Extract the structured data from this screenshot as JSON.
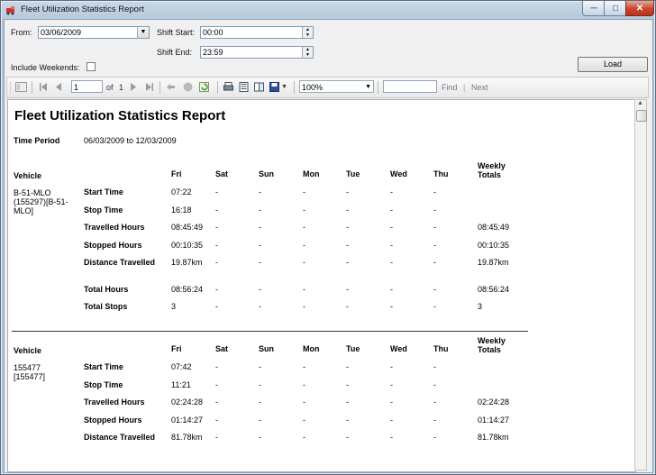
{
  "window": {
    "title": "Fleet Utilization Statistics Report",
    "min": "─",
    "max": "□",
    "close": "✕"
  },
  "params": {
    "from_label": "From:",
    "from_value": "03/06/2009",
    "shift_start_label": "Shift Start:",
    "shift_start_value": "00:00",
    "shift_end_label": "Shift End:",
    "shift_end_value": "23:59",
    "include_weekends_label": "Include Weekends:",
    "include_weekends_checked": false,
    "load_label": "Load"
  },
  "toolbar": {
    "page_value": "1",
    "of_label": "of",
    "total_pages": "1",
    "zoom": "100%",
    "find_value": "",
    "find_label": "Find",
    "sep": "|",
    "next_label": "Next"
  },
  "report": {
    "title": "Fleet Utilization Statistics Report",
    "time_period_label": "Time Period",
    "time_period_value": "06/03/2009 to 12/03/2009",
    "vehicle_label": "Vehicle",
    "days": [
      "Fri",
      "Sat",
      "Sun",
      "Mon",
      "Tue",
      "Wed",
      "Thu"
    ],
    "weekly_totals_label": [
      "Weekly",
      "Totals"
    ],
    "vehicles": [
      {
        "name": [
          "B-51-MLO",
          "(155297)[B-51-",
          "MLO]"
        ],
        "rows": [
          {
            "label": "Start Time",
            "values": [
              "07:22",
              "-",
              "-",
              "-",
              "-",
              "-",
              "-"
            ],
            "total": ""
          },
          {
            "label": "Stop Time",
            "values": [
              "16:18",
              "-",
              "-",
              "-",
              "-",
              "-",
              "-"
            ],
            "total": ""
          },
          {
            "label": "Travelled Hours",
            "values": [
              "08:45:49",
              "-",
              "-",
              "-",
              "-",
              "-",
              "-"
            ],
            "total": "08:45:49"
          },
          {
            "label": "Stopped Hours",
            "values": [
              "00:10:35",
              "-",
              "-",
              "-",
              "-",
              "-",
              "-"
            ],
            "total": "00:10:35"
          },
          {
            "label": "Distance Travelled",
            "values": [
              "19.87km",
              "-",
              "-",
              "-",
              "-",
              "-",
              "-"
            ],
            "total": "19.87km"
          },
          {
            "label": "Total Hours",
            "values": [
              "08:56:24",
              "-",
              "-",
              "-",
              "-",
              "-",
              "-"
            ],
            "total": "08:56:24"
          },
          {
            "label": "Total Stops",
            "values": [
              "3",
              "-",
              "-",
              "-",
              "-",
              "-",
              "-"
            ],
            "total": "3"
          }
        ]
      },
      {
        "name": [
          "155477",
          "[155477]"
        ],
        "rows": [
          {
            "label": "Start Time",
            "values": [
              "07:42",
              "-",
              "-",
              "-",
              "-",
              "-",
              "-"
            ],
            "total": ""
          },
          {
            "label": "Stop Time",
            "values": [
              "11:21",
              "-",
              "-",
              "-",
              "-",
              "-",
              "-"
            ],
            "total": ""
          },
          {
            "label": "Travelled Hours",
            "values": [
              "02:24:28",
              "-",
              "-",
              "-",
              "-",
              "-",
              "-"
            ],
            "total": "02:24:28"
          },
          {
            "label": "Stopped Hours",
            "values": [
              "01:14:27",
              "-",
              "-",
              "-",
              "-",
              "-",
              "-"
            ],
            "total": "01:14:27"
          },
          {
            "label": "Distance Travelled",
            "values": [
              "81.78km",
              "-",
              "-",
              "-",
              "-",
              "-",
              "-"
            ],
            "total": "81.78km"
          }
        ]
      }
    ]
  },
  "icons": [
    "app-icon",
    "document-map-icon",
    "first-page-icon",
    "previous-page-icon",
    "next-page-icon",
    "last-page-icon",
    "back-icon",
    "stop-icon",
    "refresh-icon",
    "print-icon",
    "print-layout-icon",
    "page-setup-icon",
    "export-icon"
  ]
}
